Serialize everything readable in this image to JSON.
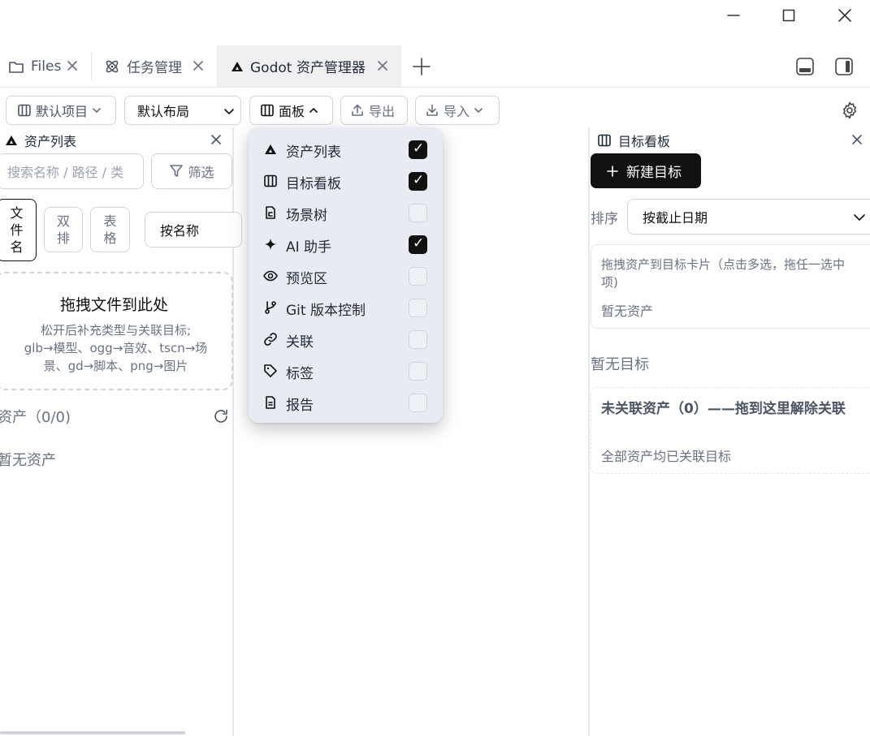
{
  "tabs": [
    {
      "label": "Files",
      "icon": "folder-icon"
    },
    {
      "label": "任务管理",
      "icon": "atom-icon"
    },
    {
      "label": "Godot 资产管理器",
      "icon": "triangle-icon"
    }
  ],
  "toolbar": {
    "project": "默认项目",
    "layout": "默认布局",
    "panels": "面板",
    "export": "导出",
    "import": "导入"
  },
  "asset_panel": {
    "title": "资产列表",
    "search_placeholder": "搜索名称 / 路径 / 类",
    "filter": "筛选",
    "view_modes": [
      "文\n件\n名",
      "双\n排",
      "表\n格"
    ],
    "sort": "按名称",
    "drop_title": "拖拽文件到此处",
    "drop_hint": "松开后补充类型与关联目标;\nglb→模型、ogg→音效、tscn→场景、gd→脚本、png→图片",
    "count_label": "资产（0/0)",
    "empty": "暂无资产"
  },
  "goal_panel": {
    "title": "目标看板",
    "new_goal": "新建目标",
    "sort_label": "排序",
    "sort_value": "按截止日期",
    "hint": "拖拽资产到目标卡片（点击多选，拖任一选中项)",
    "no_assets": "暂无资产",
    "no_goals": "暂无目标",
    "unlinked_title": "未关联资产（0）——拖到这里解除关联",
    "unlinked_sub": "全部资产均已关联目标"
  },
  "panel_menu": [
    {
      "label": "资产列表",
      "icon": "triangle-icon",
      "checked": true
    },
    {
      "label": "目标看板",
      "icon": "columns-icon",
      "checked": true
    },
    {
      "label": "场景树",
      "icon": "file-tree-icon",
      "checked": false
    },
    {
      "label": "AI 助手",
      "icon": "sparkle-icon",
      "checked": true
    },
    {
      "label": "预览区",
      "icon": "eye-icon",
      "checked": false
    },
    {
      "label": "Git 版本控制",
      "icon": "git-branch-icon",
      "checked": false
    },
    {
      "label": "关联",
      "icon": "link-icon",
      "checked": false
    },
    {
      "label": "标签",
      "icon": "tag-icon",
      "checked": false
    },
    {
      "label": "报告",
      "icon": "report-icon",
      "checked": false
    }
  ]
}
